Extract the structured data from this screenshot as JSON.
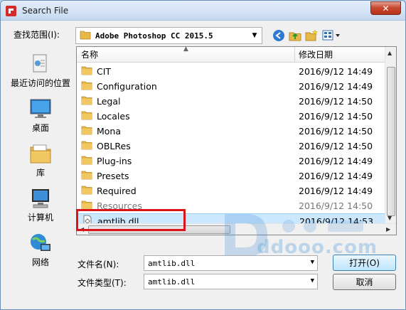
{
  "window": {
    "title": "Search File",
    "close_label": "✕"
  },
  "lookin": {
    "label": "查找范围(I):",
    "value": "Adobe Photoshop CC 2015.5"
  },
  "places": [
    {
      "label": "最近访问的位置",
      "icon": "recent-places-icon"
    },
    {
      "label": "桌面",
      "icon": "desktop-icon"
    },
    {
      "label": "库",
      "icon": "libraries-icon"
    },
    {
      "label": "计算机",
      "icon": "computer-icon"
    },
    {
      "label": "网络",
      "icon": "network-icon"
    }
  ],
  "columns": {
    "name": "名称",
    "date": "修改日期"
  },
  "files": [
    {
      "name": "CIT",
      "date": "2016/9/12 14:49",
      "type": "folder"
    },
    {
      "name": "Configuration",
      "date": "2016/9/12 14:49",
      "type": "folder"
    },
    {
      "name": "Legal",
      "date": "2016/9/12 14:50",
      "type": "folder"
    },
    {
      "name": "Locales",
      "date": "2016/9/12 14:50",
      "type": "folder"
    },
    {
      "name": "Mona",
      "date": "2016/9/12 14:50",
      "type": "folder"
    },
    {
      "name": "OBLRes",
      "date": "2016/9/12 14:50",
      "type": "folder"
    },
    {
      "name": "Plug-ins",
      "date": "2016/9/12 14:49",
      "type": "folder"
    },
    {
      "name": "Presets",
      "date": "2016/9/12 14:49",
      "type": "folder"
    },
    {
      "name": "Required",
      "date": "2016/9/12 14:49",
      "type": "folder"
    },
    {
      "name": "Resources",
      "date": "2016/9/12 14:50",
      "type": "folder"
    },
    {
      "name": "amtlib.dll",
      "date": "2016/9/12 14:53",
      "type": "file",
      "selected": true
    }
  ],
  "filename": {
    "label": "文件名(N):",
    "value": "amtlib.dll"
  },
  "filetype": {
    "label": "文件类型(T):",
    "value": "amtlib.dll"
  },
  "buttons": {
    "open": "打开(O)",
    "cancel": "取消"
  },
  "watermark": {
    "text": "ddooo.com"
  },
  "colors": {
    "highlight": "#d9141b",
    "folder": "#e9b948",
    "selection": "#cce8ff"
  }
}
